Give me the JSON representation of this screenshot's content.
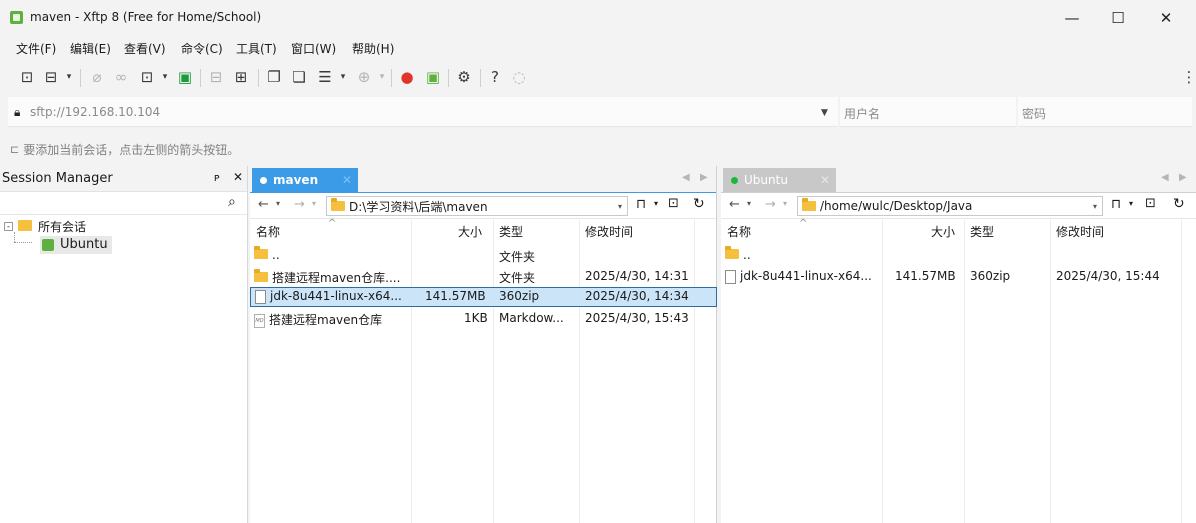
{
  "window": {
    "title": "maven - Xftp 8 (Free for Home/School)"
  },
  "menu": [
    "文件(F)",
    "编辑(E)",
    "查看(V)",
    "命令(C)",
    "工具(T)",
    "窗口(W)",
    "帮助(H)"
  ],
  "address": {
    "url": "sftp://192.168.10.104",
    "username_placeholder": "用户名",
    "password_placeholder": "密码"
  },
  "hint": "要添加当前会话，点击左侧的箭头按钮。",
  "session_manager": {
    "title": "Session Manager",
    "pin": "ᴘ",
    "close": "✕",
    "root": "所有会话",
    "child": "Ubuntu"
  },
  "local": {
    "tab": "maven",
    "path": "D:\\学习资料\\后端\\maven",
    "headers": {
      "name": "名称",
      "size": "大小",
      "type": "类型",
      "modified": "修改时间"
    },
    "files": [
      {
        "name": "..",
        "size": "",
        "type": "文件夹",
        "modified": "",
        "icon": "folder"
      },
      {
        "name": "搭建远程maven仓库....",
        "size": "",
        "type": "文件夹",
        "modified": "2025/4/30, 14:31",
        "icon": "folder"
      },
      {
        "name": "jdk-8u441-linux-x64...",
        "size": "141.57MB",
        "type": "360zip",
        "modified": "2025/4/30, 14:34",
        "icon": "file",
        "selected": true
      },
      {
        "name": "搭建远程maven仓库",
        "size": "1KB",
        "type": "Markdow...",
        "modified": "2025/4/30, 15:43",
        "icon": "md"
      }
    ]
  },
  "remote": {
    "tab": "Ubuntu",
    "path": "/home/wulc/Desktop/Java",
    "headers": {
      "name": "名称",
      "size": "大小",
      "type": "类型",
      "modified": "修改时间"
    },
    "files": [
      {
        "name": "..",
        "size": "",
        "type": "",
        "modified": "",
        "icon": "folder"
      },
      {
        "name": "jdk-8u441-linux-x64...",
        "size": "141.57MB",
        "type": "360zip",
        "modified": "2025/4/30, 15:44",
        "icon": "file"
      }
    ]
  },
  "colors": {
    "accent": "#2d8fe0",
    "local_tab_bg": "#3c9be6",
    "remote_tab_bg": "#c8c8c8",
    "remote_status": "#1db83a",
    "selection": "#cce4f7"
  }
}
